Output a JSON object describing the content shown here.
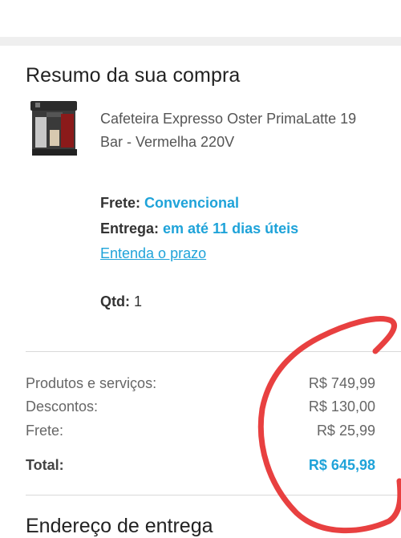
{
  "summary": {
    "title": "Resumo da sua compra",
    "product": {
      "name": "Cafeteira Expresso Oster PrimaLatte 19 Bar - Vermelha 220V",
      "image_icon": "coffee-machine-icon"
    },
    "shipping": {
      "frete_label": "Frete:",
      "frete_value": "Convencional",
      "entrega_label": "Entrega:",
      "entrega_value": "em até 11 dias úteis",
      "link": "Entenda o prazo"
    },
    "qty": {
      "label": "Qtd:",
      "value": "1"
    },
    "totals": {
      "produtos_label": "Produtos e serviços:",
      "produtos_value": "R$ 749,99",
      "descontos_label": "Descontos:",
      "descontos_value": "R$ 130,00",
      "frete_label": "Frete:",
      "frete_value": "R$ 25,99",
      "total_label": "Total:",
      "total_value": "R$ 645,98"
    }
  },
  "next_section": {
    "title": "Endereço de entrega"
  },
  "colors": {
    "accent": "#1fa3d9",
    "annotation": "#e84040"
  }
}
